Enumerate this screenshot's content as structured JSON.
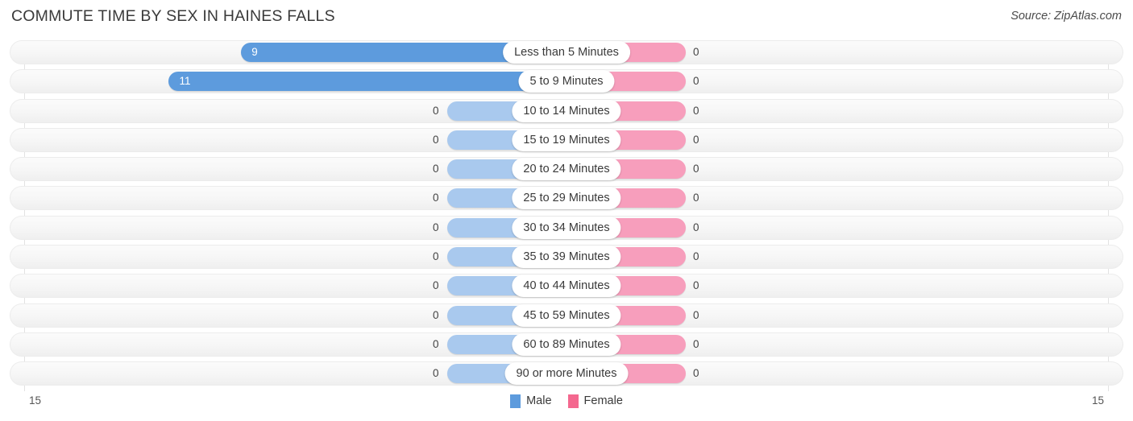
{
  "header": {
    "title": "COMMUTE TIME BY SEX IN HAINES FALLS",
    "source": "Source: ZipAtlas.com"
  },
  "legend": {
    "male_label": "Male",
    "female_label": "Female",
    "male_color": "#5d9bdd",
    "female_color": "#f4688f"
  },
  "axis": {
    "left_label": "15",
    "right_label": "15"
  },
  "chart_data": {
    "type": "bar",
    "orientation": "horizontal-diverging",
    "title": "COMMUTE TIME BY SEX IN HAINES FALLS",
    "xlabel": "",
    "ylabel": "",
    "xlim": [
      15,
      15
    ],
    "grid": true,
    "legend_position": "bottom-center",
    "categories": [
      "Less than 5 Minutes",
      "5 to 9 Minutes",
      "10 to 14 Minutes",
      "15 to 19 Minutes",
      "20 to 24 Minutes",
      "25 to 29 Minutes",
      "30 to 34 Minutes",
      "35 to 39 Minutes",
      "40 to 44 Minutes",
      "45 to 59 Minutes",
      "60 to 89 Minutes",
      "90 or more Minutes"
    ],
    "series": [
      {
        "name": "Male",
        "color": "#5d9bdd",
        "values": [
          9,
          11,
          0,
          0,
          0,
          0,
          0,
          0,
          0,
          0,
          0,
          0
        ]
      },
      {
        "name": "Female",
        "color": "#f4688f",
        "values": [
          0,
          0,
          0,
          0,
          0,
          0,
          0,
          0,
          0,
          0,
          0,
          0
        ]
      }
    ],
    "rows": [
      {
        "label": "Less than 5 Minutes",
        "male": "9",
        "female": "0"
      },
      {
        "label": "5 to 9 Minutes",
        "male": "11",
        "female": "0"
      },
      {
        "label": "10 to 14 Minutes",
        "male": "0",
        "female": "0"
      },
      {
        "label": "15 to 19 Minutes",
        "male": "0",
        "female": "0"
      },
      {
        "label": "20 to 24 Minutes",
        "male": "0",
        "female": "0"
      },
      {
        "label": "25 to 29 Minutes",
        "male": "0",
        "female": "0"
      },
      {
        "label": "30 to 34 Minutes",
        "male": "0",
        "female": "0"
      },
      {
        "label": "35 to 39 Minutes",
        "male": "0",
        "female": "0"
      },
      {
        "label": "40 to 44 Minutes",
        "male": "0",
        "female": "0"
      },
      {
        "label": "45 to 59 Minutes",
        "male": "0",
        "female": "0"
      },
      {
        "label": "60 to 89 Minutes",
        "male": "0",
        "female": "0"
      },
      {
        "label": "90 or more Minutes",
        "male": "0",
        "female": "0"
      }
    ]
  }
}
